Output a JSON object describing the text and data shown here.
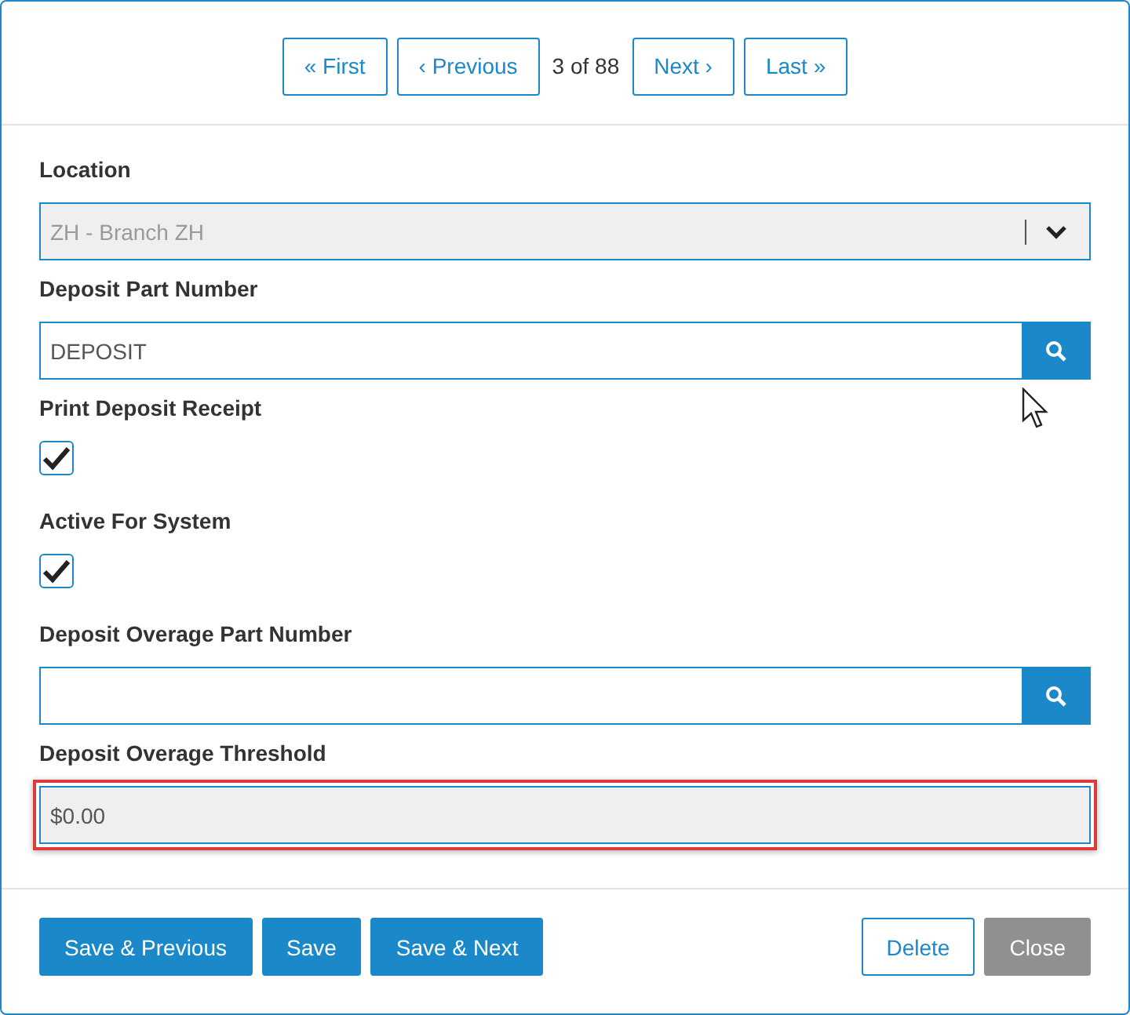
{
  "pager": {
    "buttons": [
      {
        "label": "« First"
      },
      {
        "label": "‹ Previous"
      }
    ],
    "position": "3 of 88",
    "buttons_after": [
      {
        "label": "Next ›"
      },
      {
        "label": "Last »"
      }
    ]
  },
  "fields": [
    {
      "kind": "select",
      "label": "Location",
      "value": "ZH - Branch ZH",
      "disabled": true
    },
    {
      "kind": "search",
      "label": "Deposit Part Number",
      "value": "DEPOSIT",
      "disabled": false
    },
    {
      "kind": "checkbox",
      "label": "Print Deposit Receipt",
      "checked": true
    },
    {
      "kind": "checkbox",
      "label": "Active For System",
      "checked": true
    },
    {
      "kind": "search",
      "label": "Deposit Overage Part Number",
      "disabled": false
    },
    {
      "kind": "text",
      "label": "Deposit Overage Threshold",
      "value": "$0.00",
      "disabled": true,
      "highlighted": true
    }
  ],
  "footer": {
    "left": [
      {
        "label": "Save & Previous",
        "kind": "primary"
      },
      {
        "label": "Save",
        "kind": "primary"
      },
      {
        "label": "Save & Next",
        "kind": "primary"
      }
    ],
    "right": [
      {
        "label": "Delete",
        "kind": "outline"
      },
      {
        "label": "Close",
        "kind": "muted"
      }
    ]
  }
}
